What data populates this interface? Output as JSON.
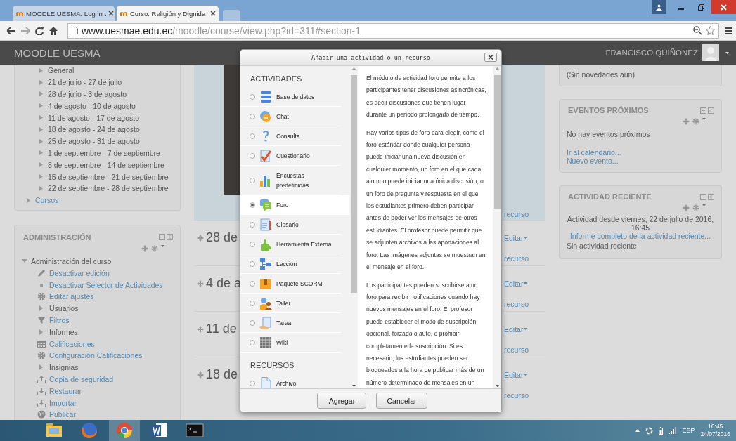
{
  "browser": {
    "tabs": [
      {
        "title": "MOODLE UESMA: Log in t",
        "selected": false
      },
      {
        "title": "Curso: Religión y Dignida",
        "selected": true
      }
    ],
    "address": {
      "domain": "www.uesmae.edu.ec",
      "path": "/moodle/course/view.php?id=311#section-1"
    }
  },
  "navbar": {
    "brand": "MOODLE UESMA",
    "user": "FRANCISCO QUIÑONEZ"
  },
  "navigation": {
    "items": [
      {
        "label": "General"
      },
      {
        "label": "21 de julio - 27 de julio"
      },
      {
        "label": "28 de julio - 3 de agosto"
      },
      {
        "label": "4 de agosto - 10 de agosto"
      },
      {
        "label": "11 de agosto - 17 de agosto"
      },
      {
        "label": "18 de agosto - 24 de agosto"
      },
      {
        "label": "25 de agosto - 31 de agosto"
      },
      {
        "label": "1 de septiembre - 7 de septiembre"
      },
      {
        "label": "8 de septiembre - 14 de septiembre"
      },
      {
        "label": "15 de septiembre - 21 de septiembre"
      },
      {
        "label": "22 de septiembre - 28 de septiembre"
      }
    ],
    "parent_items": [
      {
        "label": "Cursos"
      }
    ]
  },
  "administration": {
    "title": "ADMINISTRACIÓN",
    "tree": {
      "label": "Administración del curso",
      "expanded": true,
      "children": [
        {
          "label": "Desactivar edición",
          "kind": "edit"
        },
        {
          "label": "Desactivar Selector de Actividades",
          "kind": "bullet"
        },
        {
          "label": "Editar ajustes",
          "kind": "settings"
        },
        {
          "label": "Usuarios",
          "kind": "branch"
        },
        {
          "label": "Filtros",
          "kind": "filter"
        },
        {
          "label": "Informes",
          "kind": "branch"
        },
        {
          "label": "Calificaciones",
          "kind": "grades"
        },
        {
          "label": "Configuración Calificaciones",
          "kind": "settings"
        },
        {
          "label": "Insignias",
          "kind": "branch"
        },
        {
          "label": "Copia de seguridad",
          "kind": "backup"
        },
        {
          "label": "Restaurar",
          "kind": "restore"
        },
        {
          "label": "Importar",
          "kind": "restore"
        },
        {
          "label": "Publicar",
          "kind": "publish"
        }
      ]
    }
  },
  "course": {
    "top_link": "recurso",
    "sections": [
      {
        "title": "28 de",
        "edit": "Editar",
        "link": "recurso"
      },
      {
        "title": "4 de a",
        "edit": "Editar",
        "link": "recurso"
      },
      {
        "title": "11 de",
        "edit": "Editar",
        "link": "recurso"
      },
      {
        "title": "18 de",
        "edit": "Editar",
        "link": "recurso"
      }
    ]
  },
  "right_blocks": [
    {
      "kind": "news",
      "text": "(Sin novedades aún)"
    },
    {
      "kind": "events",
      "title": "EVENTOS PRÓXIMOS",
      "text": "No hay eventos próximos",
      "links": [
        "Ir al calendario...",
        "Nuevo evento..."
      ]
    },
    {
      "kind": "recent",
      "title": "ACTIVIDAD RECIENTE",
      "since": "Actividad desde viernes, 22 de julio de 2016, 16:45",
      "link": "Informe completo de la actividad reciente...",
      "text": "Sin actividad reciente"
    }
  ],
  "dialog": {
    "title": "Añadir una actividad o un recurso",
    "groups": [
      {
        "heading": "ACTIVIDADES",
        "modules": [
          {
            "label": "Base de datos",
            "kind": "database",
            "selected": false
          },
          {
            "label": "Chat",
            "kind": "chat",
            "selected": false
          },
          {
            "label": "Consulta",
            "kind": "choice",
            "selected": false
          },
          {
            "label": "Cuestionario",
            "kind": "quiz",
            "selected": false
          },
          {
            "label": "Encuestas predefinidas",
            "kind": "survey",
            "selected": false
          },
          {
            "label": "Foro",
            "kind": "forum",
            "selected": true
          },
          {
            "label": "Glosario",
            "kind": "glossary",
            "selected": false
          },
          {
            "label": "Herramienta Externa",
            "kind": "puzzle",
            "selected": false
          },
          {
            "label": "Lección",
            "kind": "lesson",
            "selected": false
          },
          {
            "label": "Paquete SCORM",
            "kind": "package",
            "selected": false
          },
          {
            "label": "Taller",
            "kind": "workshop",
            "selected": false
          },
          {
            "label": "Tarea",
            "kind": "assign",
            "selected": false
          },
          {
            "label": "Wiki",
            "kind": "wiki",
            "selected": false
          }
        ]
      },
      {
        "heading": "RECURSOS",
        "modules": [
          {
            "label": "Archivo",
            "kind": "file",
            "selected": false
          }
        ]
      }
    ],
    "description": [
      "El módulo de actividad foro permite a los participantes tener discusiones asincrónicas, es decir discusiones que tienen lugar durante un período prolongado de tiempo.",
      "Hay varios tipos de foro para elegir, como el foro estándar donde cualquier persona puede iniciar una nueva discusión en cualquier momento, un foro en el que cada alumno puede iniciar una única discusión, o un foro de pregunta y respuesta en el que los estudiantes primero deben participar antes de poder ver los mensajes de otros estudiantes. El profesor puede permitir que se adjunten archivos a las aportaciones al foro. Las imágenes adjuntas se muestran en el mensaje en el foro.",
      "Los participantes pueden suscribirse a un foro para recibir notificaciones cuando hay nuevos mensajes en el foro. El profesor puede establecer el modo de suscripción, opcional, forzado o auto, o prohibir completamente la suscripción. Si es necesario, los estudiantes pueden ser bloqueados a la hora de publicar más de un número determinado de mensajes en un"
    ],
    "buttons": [
      "Agregar",
      "Cancelar"
    ]
  },
  "taskbar": {
    "apps": [
      {
        "kind": "folder",
        "selected": false
      },
      {
        "kind": "firefox",
        "selected": false
      },
      {
        "kind": "chrome",
        "selected": true
      },
      {
        "kind": "word",
        "selected": false
      },
      {
        "kind": "terminal",
        "selected": false
      }
    ],
    "language": "ESP",
    "time": "16:45",
    "date": "24/07/2016"
  }
}
